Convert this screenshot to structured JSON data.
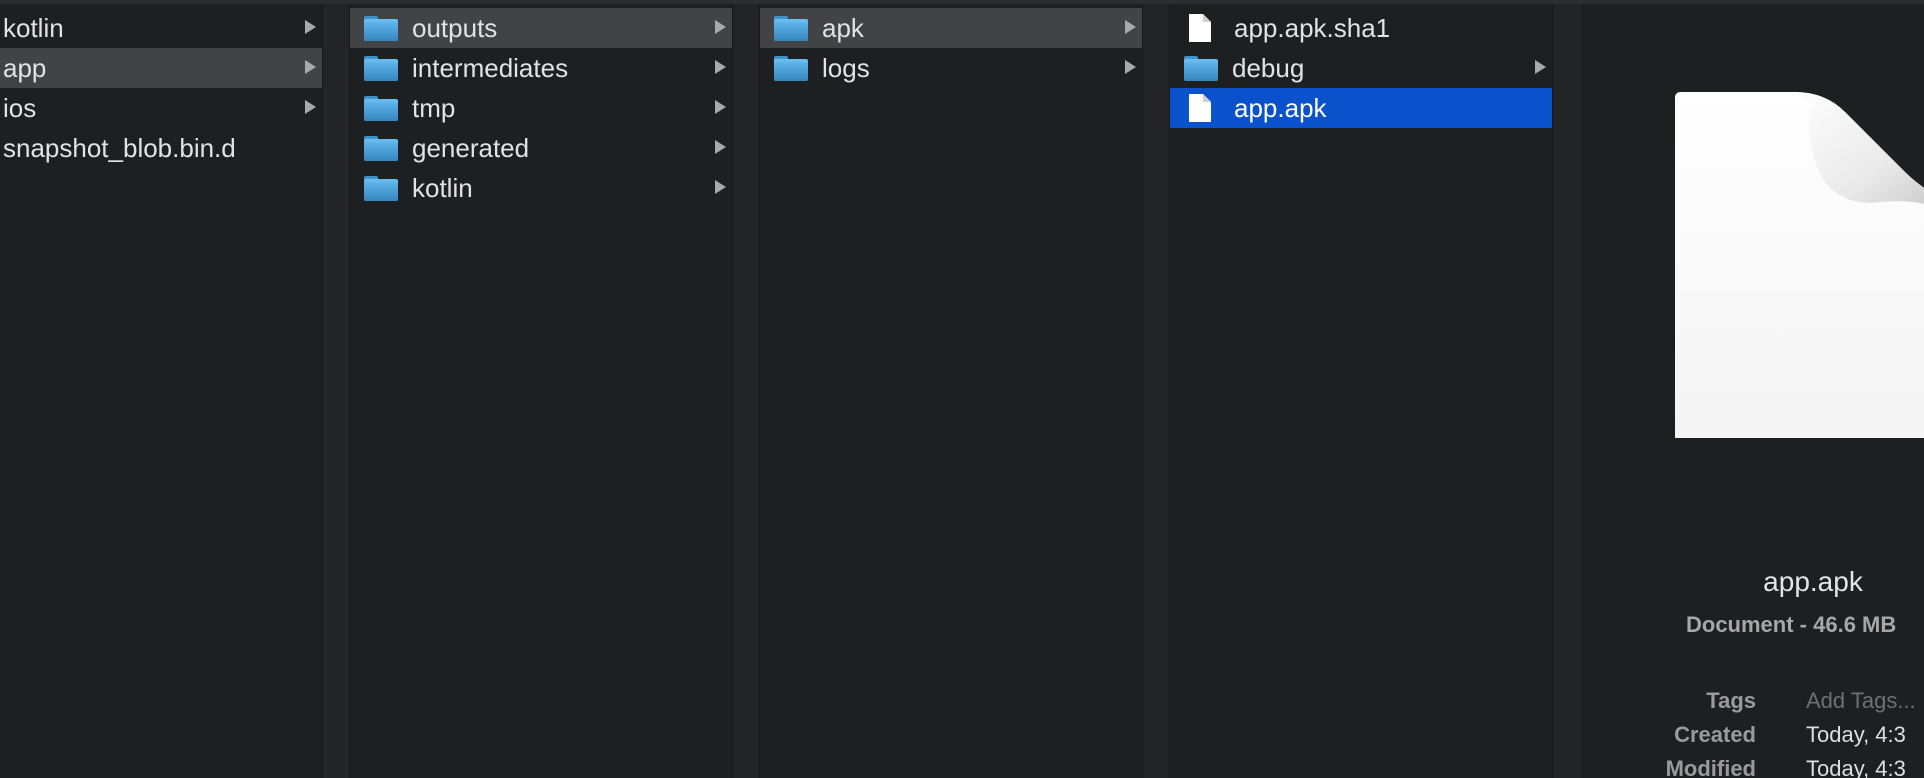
{
  "columns": [
    {
      "items": [
        {
          "label": "kotlin",
          "icon": "none",
          "has_children": true,
          "state": "normal"
        },
        {
          "label": "app",
          "icon": "none",
          "has_children": true,
          "state": "highlight"
        },
        {
          "label": "ios",
          "icon": "none",
          "has_children": true,
          "state": "normal"
        },
        {
          "label": "snapshot_blob.bin.d",
          "icon": "none",
          "has_children": false,
          "state": "normal"
        }
      ]
    },
    {
      "items": [
        {
          "label": "outputs",
          "icon": "folder-icon",
          "has_children": true,
          "state": "highlight"
        },
        {
          "label": "intermediates",
          "icon": "folder-icon",
          "has_children": true,
          "state": "normal"
        },
        {
          "label": "tmp",
          "icon": "folder-icon",
          "has_children": true,
          "state": "normal"
        },
        {
          "label": "generated",
          "icon": "folder-icon",
          "has_children": true,
          "state": "normal"
        },
        {
          "label": "kotlin",
          "icon": "folder-icon",
          "has_children": true,
          "state": "normal"
        }
      ]
    },
    {
      "items": [
        {
          "label": "apk",
          "icon": "folder-icon",
          "has_children": true,
          "state": "highlight"
        },
        {
          "label": "logs",
          "icon": "folder-icon",
          "has_children": true,
          "state": "normal"
        }
      ]
    },
    {
      "items": [
        {
          "label": "app.apk.sha1",
          "icon": "document-icon",
          "has_children": false,
          "state": "normal"
        },
        {
          "label": "debug",
          "icon": "folder-icon",
          "has_children": true,
          "state": "normal"
        },
        {
          "label": "app.apk",
          "icon": "document-icon",
          "has_children": false,
          "state": "selected"
        }
      ]
    }
  ],
  "preview": {
    "icon": "document-large-icon",
    "name": "app.apk",
    "kind": "Document - 46.6 MB",
    "meta": [
      {
        "key": "Tags",
        "value": "Add Tags...",
        "placeholder": true
      },
      {
        "key": "Created",
        "value": "Today, 4:3",
        "placeholder": false
      },
      {
        "key": "Modified",
        "value": "Today, 4:3",
        "placeholder": false
      }
    ]
  },
  "colors": {
    "background": "#1e1f21",
    "highlight": "#424345",
    "selection": "#0a52cc",
    "folder": "#5cb2e8"
  }
}
